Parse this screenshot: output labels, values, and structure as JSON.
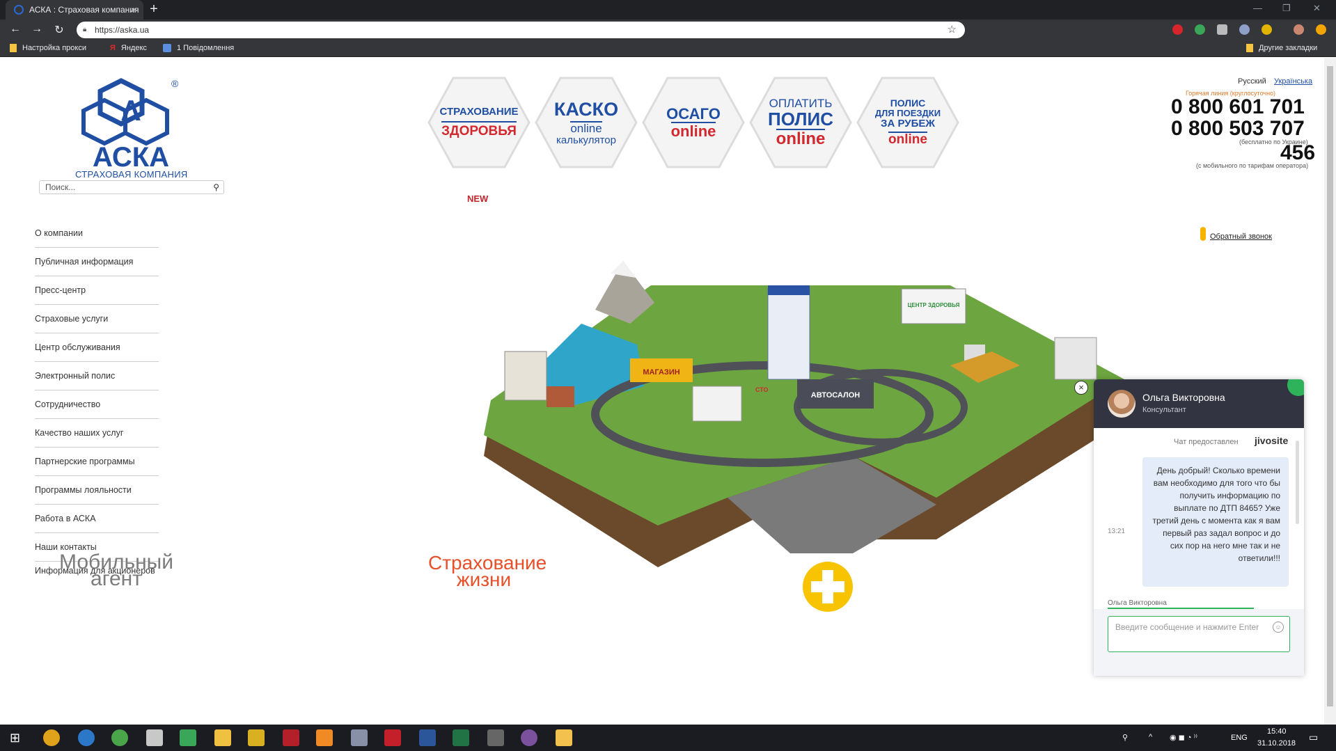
{
  "browser": {
    "tab_title": "АСКА : Страховая компания",
    "tab_close": "×",
    "new_tab": "+",
    "url": "https://aska.ua",
    "bookmarks": [
      "Настройка прокси",
      "Яндекс",
      "1 Повідомлення"
    ],
    "other_bookmarks": "Другие закладки"
  },
  "site": {
    "logo_text": "АСКА",
    "logo_sub": "СТРАХОВАЯ КОМПАНИЯ",
    "search_placeholder": "Поиск...",
    "menu": [
      "О компании",
      "Публичная информация",
      "Пресс-центр",
      "Страховые услуги",
      "Центр обслуживания",
      "Электронный полис",
      "Сотрудничество",
      "Качество наших услуг",
      "Партнерские программы",
      "Программы лояльности",
      "Работа в АСКА",
      "Наши контакты",
      "Информация для акционеров"
    ],
    "products": [
      {
        "l1": "СТРАХОВАНИЕ",
        "l2": "ЗДОРОВЬЯ"
      },
      {
        "l1": "КАСКО",
        "l2": "online",
        "l3": "калькулятор"
      },
      {
        "l1": "ОСАГО",
        "l2": "online"
      },
      {
        "l1": "ОПЛАТИТЬ",
        "l2": "ПОЛИС",
        "l3": "online"
      },
      {
        "l1": "ПОЛИС",
        "l2": "ДЛЯ ПОЕЗДКИ",
        "l3": "ЗА РУБЕЖ",
        "l4": "online"
      }
    ],
    "new_label": "NEW",
    "lang_ru": "Русский",
    "lang_ua": "Українська",
    "hotline_label": "Горячая линия (круглосуточно)",
    "phone1": "0 800 601 701",
    "phone2": "0 800 503 707",
    "phone_note1": "(бесплатно по Украине)",
    "phone3": "456",
    "phone_note2": "(с мобильного по тарифам оператора)",
    "callback": "Обратный звонок",
    "bottom_mobile": "Мобильный агент",
    "bottom_life": "Страхование жизни",
    "city_labels": [
      "МАГАЗИН",
      "СТО",
      "АВТОСАЛОН",
      "ЦЕНТР ЗДОРОВЬЯ"
    ]
  },
  "chat": {
    "agent_name": "Ольга Викторовна",
    "agent_role": "Консультант",
    "provided_by": "Чат предоставлен",
    "provider": "jivosite",
    "msg_time": "13:21",
    "message": "День добрый! Сколько времени вам необходимо для того что бы получить информацию по выплате по ДТП 8465? Уже третий день с момента как я вам первый раз задал вопрос и до сих пор на него мне так и не ответили!!!",
    "operator_label": "Ольга Викторовна",
    "input_placeholder": "Введите сообщение и нажмите Enter",
    "close": "×"
  },
  "taskbar": {
    "lang": "ENG",
    "time": "15:40",
    "date": "31.10.2018"
  },
  "colors": {
    "brand_blue": "#1f4ea3",
    "brand_red": "#d2282e",
    "chat_header": "#323441",
    "chat_accent": "#2fb35a"
  }
}
